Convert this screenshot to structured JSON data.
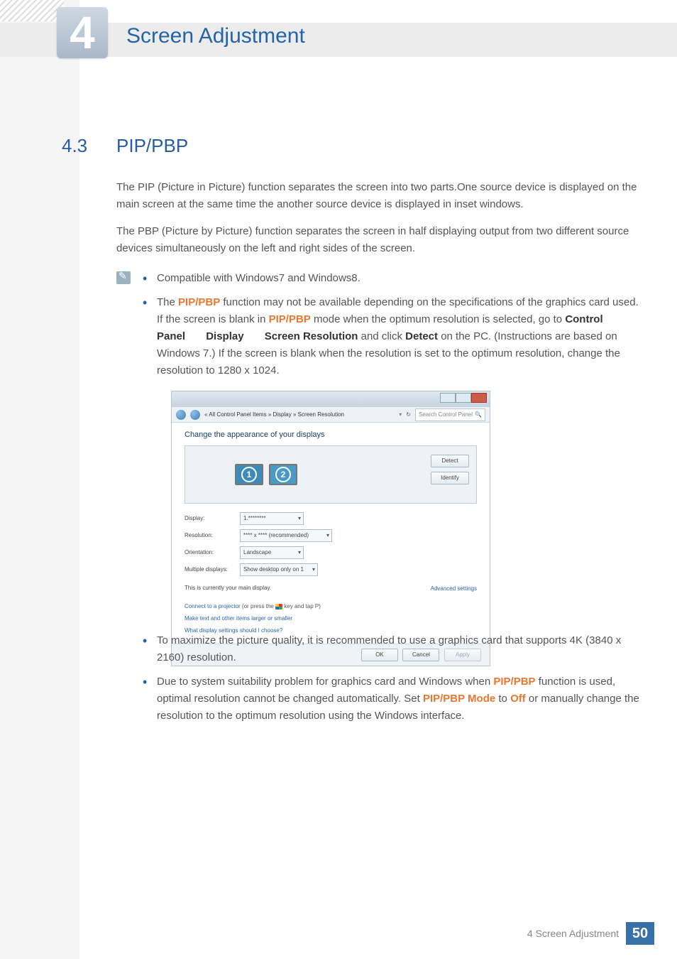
{
  "chapter": {
    "number": "4",
    "title": "Screen Adjustment"
  },
  "section": {
    "num": "4.3",
    "title": "PIP/PBP"
  },
  "para1": "The PIP (Picture in Picture) function separates the screen into two parts.One source device is displayed on the main screen at the same time the another source device is displayed in inset windows.",
  "para2": "The PBP (Picture by Picture) function separates the screen in half displaying output from two different source devices simultaneously on the left and right sides of the screen.",
  "bullets_top": {
    "b1": "Compatible with Windows7 and Windows8.",
    "b2_a": "The ",
    "b2_pip": "PIP/PBP",
    "b2_b": " function may not be available depending on the specifications of the graphics card used. If the screen is blank in ",
    "b2_c": " mode when the optimum resolution is selected, go to ",
    "b2_cp": "Control Panel",
    "b2_arrow": " ",
    "b2_disp": "Display",
    "b2_sr": "Screen Resolution",
    "b2_d": " and click ",
    "b2_detect": "Detect",
    "b2_e": " on the PC. (Instructions are based on Windows 7.) If the screen is blank when the resolution is set to the optimum resolution, change the resolution to 1280 x 1024."
  },
  "bullets_bottom": {
    "b3": "To maximize the picture quality, it is recommended to use a graphics card that supports 4K (3840 x 2160) resolution.",
    "b4_a": "Due to system suitability problem for graphics card and Windows when ",
    "b4_pip": "PIP/PBP",
    "b4_b": " function is used, optimal resolution cannot be changed automatically. Set ",
    "b4_mode": "PIP/PBP Mode",
    "b4_to": " to ",
    "b4_off": "Off",
    "b4_c": " or manually change the resolution to the optimum resolution using the Windows interface."
  },
  "dialog": {
    "breadcrumb": "« All Control Panel Items » Display » Screen Resolution",
    "search_placeholder": "Search Control Panel",
    "heading": "Change the appearance of your displays",
    "monitor1": "1",
    "monitor2": "2",
    "btn_detect": "Detect",
    "btn_identify": "Identify",
    "display_label": "Display:",
    "display_value": "1.********",
    "resolution_label": "Resolution:",
    "resolution_value": "**** x **** (recommended)",
    "orientation_label": "Orientation:",
    "orientation_value": "Landscape",
    "multiple_label": "Multiple displays:",
    "multiple_value": "Show desktop only on 1",
    "main_display_note": "This is currently your main display.",
    "advanced": "Advanced settings",
    "link1a": "Connect to a projector",
    "link1b": " (or press the ",
    "link1c": " key and tap P)",
    "link2": "Make text and other items larger or smaller",
    "link3": "What display settings should I choose?",
    "ok": "OK",
    "cancel": "Cancel",
    "apply": "Apply"
  },
  "footer": {
    "title": "4 Screen Adjustment",
    "page": "50"
  }
}
